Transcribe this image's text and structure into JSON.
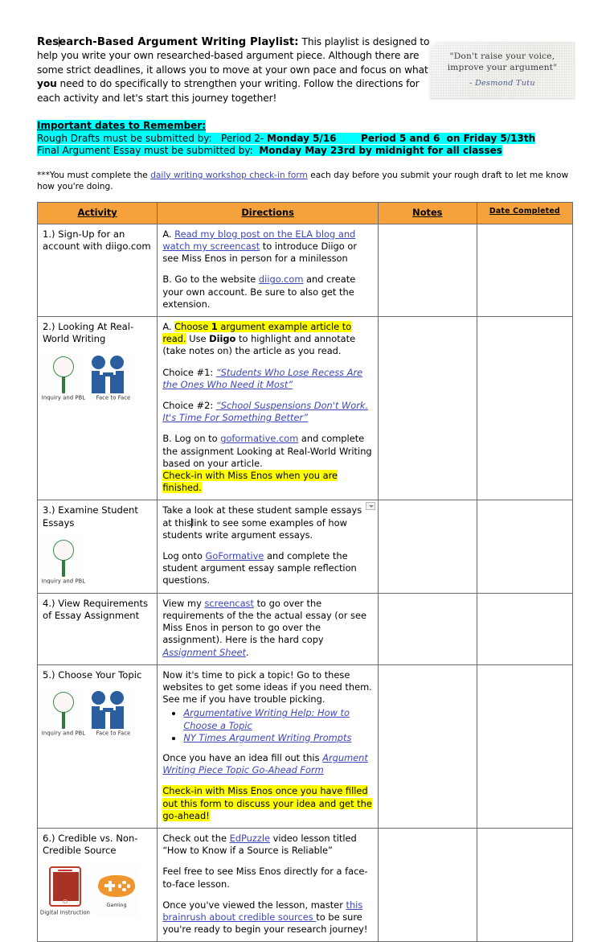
{
  "intro": {
    "title": "Research-Based Argument Writing Playlist:",
    "body_part1": "This playlist is designed to help you write your own researched-based argument piece.  Although there are some strict deadlines, it allows you to move at your own pace and focus on what ",
    "body_emphasis": "you",
    "body_part2": " need to do specifically to strengthen your writing.  Follow the directions for each activity and let's start this journey together!"
  },
  "quote": {
    "line1": "\"Don't raise your voice,",
    "line2": "improve your argument\"",
    "attribution": "- Desmond Tutu"
  },
  "dates": {
    "heading": "Important dates to Remember:",
    "rough_label": "Rough Drafts must be submitted by:   Period 2- ",
    "rough_bold1": "Monday 5/16",
    "rough_gap": "        ",
    "rough_bold2": "Period 5 and 6  on Friday 5/13th",
    "final_label": "Final Argument Essay must be submitted by:  ",
    "final_bold": "Monday May 23rd by midnight for all classes"
  },
  "note": {
    "pre": "***You must complete the ",
    "link": "daily writing workshop check-in form",
    "post": " each day before you submit your rough draft to let me know how you're doing."
  },
  "table": {
    "headers": {
      "activity": "Activity",
      "directions": "Directions",
      "notes": "Notes",
      "date_completed": "Date Completed"
    },
    "rows": [
      {
        "activity": "1.) Sign-Up for an account with diigo.com",
        "icons": [],
        "directions": [
          {
            "segments": [
              {
                "t": "A. "
              },
              {
                "t": "Read my blog post on the ELA blog and watch my screencast",
                "link": true
              },
              {
                "t": " to introduce Diigo or see Miss Enos in person for a minilesson"
              }
            ]
          },
          {
            "segments": [
              {
                "t": "B. Go to the website "
              },
              {
                "t": "diigo.com",
                "link": true
              },
              {
                "t": " and create your own account. Be sure to also get the extension."
              }
            ]
          }
        ],
        "notes": "",
        "date_completed": ""
      },
      {
        "activity": "2.) Looking At Real-World Writing",
        "icons": [
          "inquiry-and-pbl",
          "face-to-face"
        ],
        "directions": [
          {
            "segments": [
              {
                "t": "A. "
              },
              {
                "t": "Choose ",
                "hl": "yellow"
              },
              {
                "t": "1",
                "hl": "yellow",
                "bold": true
              },
              {
                "t": " argument example article to read.",
                "hl": "yellow"
              },
              {
                "t": " Use "
              },
              {
                "t": "Diigo",
                "bold": true
              },
              {
                "t": " to highlight and annotate (take notes on) the article as you read."
              }
            ]
          },
          {
            "segments": [
              {
                "t": "Choice #1: "
              },
              {
                "t": "“Students Who Lose Recess Are the Ones Who Need it Most”",
                "link": true,
                "italic": true
              }
            ]
          },
          {
            "segments": [
              {
                "t": "Choice #2: "
              },
              {
                "t": "“School Suspensions Don't Work.  It's Time For Something Better”",
                "link": true,
                "italic": true
              }
            ]
          },
          {
            "segments": [
              {
                "t": "B. Log on to "
              },
              {
                "t": "goformative.com",
                "link": true
              },
              {
                "t": " and complete the assignment Looking at Real-World Writing based on your article."
              },
              {
                "t": "\n"
              },
              {
                "t": "Check-in with Miss Enos when you are finished.",
                "hl": "yellow"
              }
            ]
          }
        ],
        "notes": "",
        "date_completed": ""
      },
      {
        "activity": "3.)  Examine Student Essays",
        "icons": [
          "inquiry-and-pbl"
        ],
        "has_anchor_mark": true,
        "directions": [
          {
            "segments": [
              {
                "t": "Take a look at these student sample essays at this"
              },
              {
                "caret": true
              },
              {
                "t": "link  to see some examples of how students write argument essays."
              }
            ]
          },
          {
            "segments": [
              {
                "t": "Log onto "
              },
              {
                "t": "GoFormative",
                "link": true
              },
              {
                "t": " and complete the student argument essay sample reflection questions."
              }
            ]
          }
        ],
        "notes": "",
        "date_completed": ""
      },
      {
        "activity": "4.) View Requirements of Essay Assignment",
        "icons": [],
        "directions": [
          {
            "segments": [
              {
                "t": "View my "
              },
              {
                "t": "screencast",
                "link": true
              },
              {
                "t": " to go over the requirements of the  the actual essay (or see Miss Enos in person to go over the assignment). Here is the hard copy "
              },
              {
                "t": "Assignment Sheet",
                "link": true,
                "italic": true
              },
              {
                "t": "."
              }
            ]
          }
        ],
        "notes": "",
        "date_completed": ""
      },
      {
        "activity": "5.) Choose Your Topic",
        "icons": [
          "inquiry-and-pbl",
          "face-to-face"
        ],
        "directions": [
          {
            "segments": [
              {
                "t": "Now it's time to pick a topic! Go to these websites to get some ideas if you need them. See me if you have trouble picking."
              }
            ],
            "bullets": [
              "Argumentative Writing Help: How to Choose a Topic",
              "NY Times Argument Writing Prompts"
            ]
          },
          {
            "segments": [
              {
                "t": "Once you have an idea fill out this "
              },
              {
                "t": "Argument Writing Piece Topic Go-Ahead Form",
                "link": true,
                "italic": true
              }
            ]
          },
          {
            "segments": [
              {
                "t": "Check-in with Miss Enos once you have filled out this form to discuss your idea and get the go-ahead!",
                "hl": "yellow"
              }
            ]
          }
        ],
        "notes": "",
        "date_completed": ""
      },
      {
        "activity": "6.) Credible vs. Non-Credible Source",
        "icons": [
          "digital-instruction",
          "gaming"
        ],
        "directions": [
          {
            "segments": [
              {
                "t": "Check out the "
              },
              {
                "t": "EdPuzzle",
                "link": true
              },
              {
                "t": " video lesson titled “How to Know if a Source is Reliable”"
              }
            ]
          },
          {
            "segments": [
              {
                "t": "Feel free to see Miss Enos directly for a face-to-face lesson."
              }
            ]
          },
          {
            "segments": [
              {
                "t": "Once you've viewed the lesson, master "
              },
              {
                "t": "this brainrush about credible sources ",
                "link": true
              },
              {
                "t": "to be sure you're ready to begin your research journey!"
              }
            ]
          }
        ],
        "notes": "",
        "date_completed": ""
      }
    ]
  },
  "icon_labels": {
    "inquiry_and_pbl": "Inquiry and PBL",
    "face_to_face": "Face to Face",
    "digital_instruction": "Digital Instruction",
    "gaming": "Gaming"
  },
  "colors": {
    "header_orange": "#f5a23c",
    "highlight_cyan": "#00ffff",
    "highlight_yellow": "#ffff00",
    "link_blue": "#3b46b8",
    "icon_green": "#3a8f4a",
    "icon_blue": "#2a5e9e",
    "icon_red": "#a93226",
    "icon_orange": "#f0962e"
  }
}
